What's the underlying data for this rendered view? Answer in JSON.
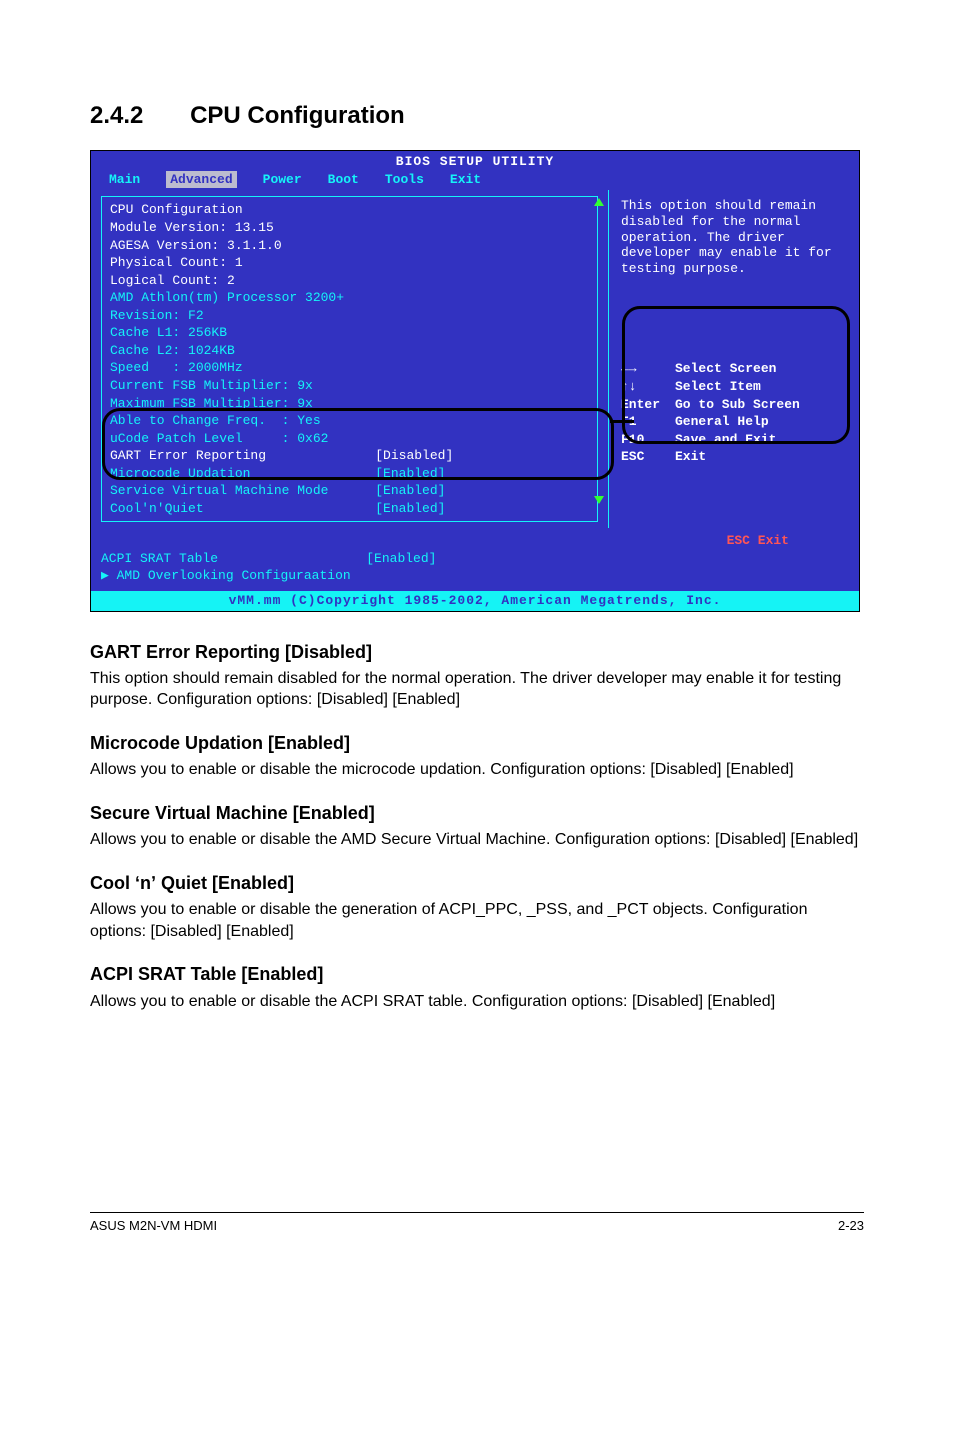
{
  "section": {
    "number": "2.4.2",
    "title": "CPU Configuration"
  },
  "bios": {
    "title": "BIOS SETUP UTILITY",
    "menu": [
      "Main",
      "Advanced",
      "Power",
      "Boot",
      "Tools",
      "Exit"
    ],
    "selected_menu": "Advanced",
    "left_white": [
      "CPU Configuration",
      "Module Version: 13.15",
      "AGESA Version: 3.1.1.0",
      "Physical Count: 1",
      "Logical Count: 2"
    ],
    "left_cyan": [
      "AMD Athlon(tm) Processor 3200+",
      "Revision: F2",
      "Cache L1: 256KB",
      "Cache L2: 1024KB",
      "Speed   : 2000MHz",
      "Current FSB Multiplier: 9x",
      "Maximum FSB Multiplier: 9x",
      "Able to Change Freq.  : Yes",
      "uCode Patch Level     : 0x62"
    ],
    "left_settings": [
      {
        "label": "GART Error Reporting",
        "value": "[Disabled]",
        "color": "white"
      },
      {
        "label": "Microcode Updation",
        "value": "[Enabled]",
        "color": "cyan"
      },
      {
        "label": "Service Virtual Machine Mode",
        "value": "[Enabled]",
        "color": "cyan"
      },
      {
        "label": "Cool'n'Quiet",
        "value": "[Enabled]",
        "color": "cyan"
      }
    ],
    "extra": [
      {
        "label": "ACPI SRAT Table",
        "value": "[Enabled]"
      },
      {
        "label": "▶ AMD Overlooking Configuraation",
        "value": ""
      }
    ],
    "help_text": "This option should remain disabled for the normal operation. The driver developer may enable it for testing purpose.",
    "keys": [
      {
        "k": "←→",
        "d": "Select Screen"
      },
      {
        "k": "↑↓",
        "d": "Select Item"
      },
      {
        "k": "Enter",
        "d": "Go to Sub Screen"
      },
      {
        "k": "F1",
        "d": "General Help"
      },
      {
        "k": "F10",
        "d": "Save and Exit"
      },
      {
        "k": "ESC",
        "d": "Exit"
      }
    ],
    "extra_key": "ESC    Exit",
    "copyright": "vMM.mm (C)Copyright 1985-2002, American Megatrends, Inc."
  },
  "paragraphs": [
    {
      "heading": "GART Error Reporting [Disabled]",
      "text": "This option should remain disabled for the normal operation. The driver developer may enable it for testing purpose. Configuration options: [Disabled] [Enabled]"
    },
    {
      "heading": "Microcode Updation [Enabled]",
      "text": "Allows you to enable or disable the microcode updation. Configuration options: [Disabled] [Enabled]"
    },
    {
      "heading": "Secure Virtual Machine [Enabled]",
      "text": "Allows you to enable or disable the AMD Secure Virtual Machine. Configuration options: [Disabled] [Enabled]"
    },
    {
      "heading": "Cool ʻnʼ Quiet [Enabled]",
      "text": "Allows you to enable or disable the generation of ACPI_PPC, _PSS, and _PCT objects. Configuration options: [Disabled] [Enabled]"
    },
    {
      "heading": "ACPI SRAT Table [Enabled]",
      "text": "Allows you to enable or disable the ACPI SRAT table. Configuration options: [Disabled] [Enabled]"
    }
  ],
  "footer": {
    "left": "ASUS M2N-VM HDMI",
    "right": "2-23"
  }
}
